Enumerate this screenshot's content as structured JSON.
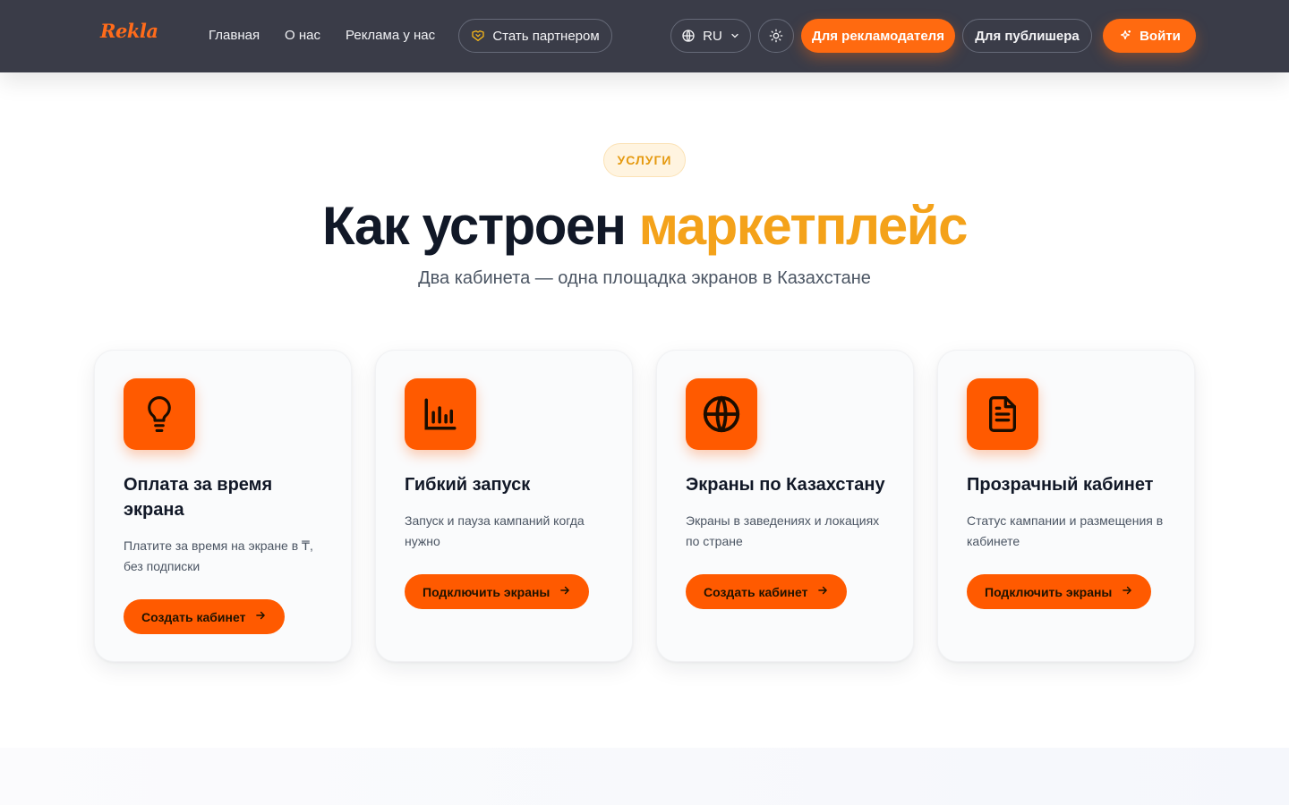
{
  "header": {
    "logo": "Rekla",
    "nav": [
      "Главная",
      "О нас",
      "Реклама у нас"
    ],
    "partner_label": "Стать партнером",
    "lang_label": "RU",
    "advertiser_label": "Для рекламодателя",
    "publisher_label": "Для публишера",
    "login_label": "Войти"
  },
  "section": {
    "badge": "УСЛУГИ",
    "title_main": "Как устроен ",
    "title_accent": "маркетплейс",
    "subtitle": "Два кабинета — одна площадка экранов в Казахстане"
  },
  "cards": [
    {
      "icon": "lightbulb-icon",
      "title": "Оплата за время экрана",
      "text": "Платите за время на экране в ₸, без подписки",
      "button": "Создать кабинет"
    },
    {
      "icon": "bar-chart-icon",
      "title": "Гибкий запуск",
      "text": "Запуск и пауза кампаний когда нужно",
      "button": "Подключить экраны"
    },
    {
      "icon": "globe-icon",
      "title": "Экраны по Казахстану",
      "text": "Экраны в заведениях и локациях по стране",
      "button": "Создать кабинет"
    },
    {
      "icon": "document-icon",
      "title": "Прозрачный кабинет",
      "text": "Статус кампании и размещения в кабинете",
      "button": "Подключить экраны"
    }
  ],
  "colors": {
    "header_bg": "#3a3c48",
    "accent_orange": "#ff5a00",
    "title_accent": "#f4a21a"
  }
}
